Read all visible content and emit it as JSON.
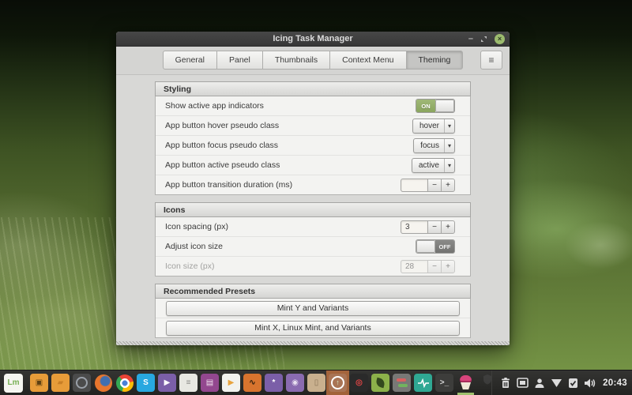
{
  "window": {
    "title": "Icing Task Manager",
    "controls": {
      "minimize": "–",
      "close": "×"
    },
    "tabs": [
      {
        "label": "General"
      },
      {
        "label": "Panel"
      },
      {
        "label": "Thumbnails"
      },
      {
        "label": "Context Menu"
      },
      {
        "label": "Theming",
        "active": true
      }
    ],
    "menu_icon": "≡"
  },
  "sections": {
    "styling": {
      "title": "Styling",
      "rows": [
        {
          "label": "Show active app indicators",
          "type": "toggle",
          "value": "ON"
        },
        {
          "label": "App button hover pseudo class",
          "type": "dropdown",
          "value": "hover"
        },
        {
          "label": "App button focus pseudo class",
          "type": "dropdown",
          "value": "focus"
        },
        {
          "label": "App button active pseudo class",
          "type": "dropdown",
          "value": "active"
        },
        {
          "label": "App button transition duration (ms)",
          "type": "spinner",
          "value": ""
        }
      ]
    },
    "icons": {
      "title": "Icons",
      "rows": [
        {
          "label": "Icon spacing (px)",
          "type": "spinner",
          "value": "3"
        },
        {
          "label": "Adjust icon size",
          "type": "toggle",
          "value": "OFF"
        },
        {
          "label": "Icon size (px)",
          "type": "spinner",
          "value": "28",
          "disabled": true
        }
      ]
    },
    "presets": {
      "title": "Recommended Presets",
      "buttons": [
        {
          "label": "Mint Y and Variants"
        },
        {
          "label": "Mint X, Linux Mint, and Variants"
        }
      ]
    }
  },
  "ui": {
    "minus": "−",
    "plus": "+",
    "dropdown_arrow": "▾"
  },
  "taskbar": {
    "clock": "20:43",
    "apps": [
      {
        "name": "mint-menu",
        "bg": "#f5f5f0",
        "glyph": "Lm",
        "color": "#77b054",
        "bold": true
      },
      {
        "name": "files",
        "bg": "#e79c39",
        "glyph": "▣",
        "color": "#5c4012"
      },
      {
        "name": "folder",
        "bg": "#e79c39",
        "glyph": "▰",
        "color": "#c87f26"
      },
      {
        "name": "screenshot-tool",
        "bg": "#4b4b4b",
        "special": "ring"
      },
      {
        "name": "firefox",
        "special": "firefox"
      },
      {
        "name": "chrome",
        "special": "chrome"
      },
      {
        "name": "skype",
        "bg": "#28a8e0",
        "glyph": "S",
        "color": "#ffffff",
        "bold": true
      },
      {
        "name": "media-player",
        "bg": "#7b5fa8",
        "glyph": "▶",
        "color": "#ffffff"
      },
      {
        "name": "libreoffice",
        "bg": "#e8e8e2",
        "glyph": "≡",
        "color": "#8a8a86"
      },
      {
        "name": "document-app",
        "bg": "#93478f",
        "glyph": "▤",
        "color": "#f0e0ee"
      },
      {
        "name": "video-app",
        "bg": "#f2f2ee",
        "glyph": "▶",
        "color": "#e8a33d"
      },
      {
        "name": "game-app",
        "bg": "#d8742e",
        "glyph": "∿",
        "color": "#3a2410",
        "bold": true
      },
      {
        "name": "paint-app",
        "bg": "#7b5fa8",
        "glyph": "*",
        "color": "#ffffff",
        "bold": true
      },
      {
        "name": "webcam-app",
        "bg": "#8a6bb0",
        "glyph": "◉",
        "color": "#e8e0f0"
      },
      {
        "name": "package-app",
        "bg": "#c9b08e",
        "glyph": "▯",
        "color": "#8a7356"
      },
      {
        "name": "update-manager",
        "bg": "#5b9bd5",
        "special": "updates",
        "highlight": true
      },
      {
        "name": "screen-recorder",
        "bg": "#2a2a2a",
        "glyph": "◎",
        "color": "#e04545",
        "bold": true
      },
      {
        "name": "leaf-app",
        "bg": "#8cb14a",
        "special": "leaf"
      },
      {
        "name": "tweaks-app",
        "bg": "#787876",
        "special": "toggles"
      },
      {
        "name": "system-monitor",
        "bg": "#2fa893",
        "special": "pulse"
      },
      {
        "name": "terminal",
        "bg": "#3d3d3b",
        "glyph": ">_",
        "color": "#dddddd",
        "bold": true
      },
      {
        "name": "icing-task-manager",
        "special": "cupcake",
        "active": true
      }
    ],
    "tray": [
      "trash-icon",
      "screenshot-icon",
      "user-icon",
      "network-icon",
      "updates-icon",
      "volume-icon"
    ]
  }
}
